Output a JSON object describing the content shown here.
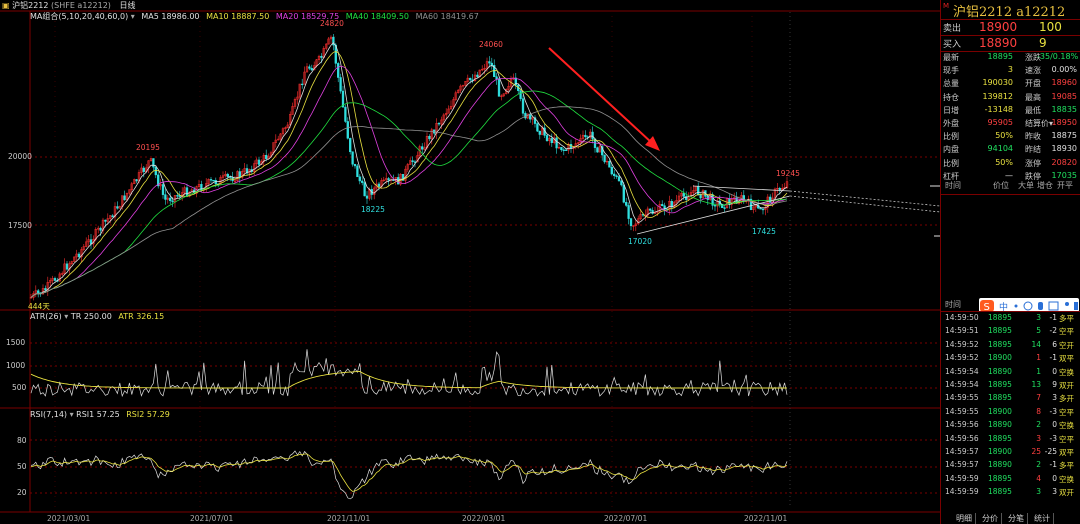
{
  "header": {
    "symbol": "沪铝2212",
    "exchange": "(SHFE a12212)",
    "period": "日线"
  },
  "ma": {
    "label": "MA组合(5,10,20,40,60,0)",
    "items": [
      {
        "text": "MA5 18986.00",
        "color": "#e0e0e0"
      },
      {
        "text": "MA10 18887.50",
        "color": "#e8e040"
      },
      {
        "text": "MA20 18529.75",
        "color": "#e040e0"
      },
      {
        "text": "MA40 18409.50",
        "color": "#20e040"
      },
      {
        "text": "MA60 18419.67",
        "color": "#909090"
      }
    ]
  },
  "atr": {
    "label": "ATR(26)",
    "tr": "TR 250.00",
    "atr": "ATR 326.15"
  },
  "rsi": {
    "label": "RSI(7,14)",
    "rsi1": "RSI1 57.25",
    "rsi2": "RSI2 57.29"
  },
  "price_axis": [
    "20000",
    "17500"
  ],
  "atr_axis": [
    "1500",
    "1000",
    "500"
  ],
  "rsi_axis": [
    "80",
    "50",
    "20"
  ],
  "date_axis": [
    "2021/03/01",
    "2021/07/01",
    "2021/11/01",
    "2022/03/01",
    "2022/07/01",
    "2022/11/01"
  ],
  "annotations": {
    "p24820": "24820",
    "p24060": "24060",
    "p20195": "20195",
    "p18225": "18225",
    "p17020": "17020",
    "p17425": "17425",
    "p19245": "19245",
    "low": "444天"
  },
  "colors": {
    "candle_up": "#ff3030",
    "candle_down": "#30e0e0",
    "arrow": "#ff2020",
    "grid": "#7a0000"
  },
  "right_panel": {
    "m": "M",
    "title": "沪铝2212 a12212",
    "sell": {
      "label": "卖出",
      "price": "18900",
      "vol": "100"
    },
    "buy": {
      "label": "买入",
      "price": "18890",
      "vol": "9"
    },
    "quotes": [
      {
        "k1": "最新",
        "v1": "18895",
        "c1": "grn",
        "k2": "涨跌",
        "v2": "-35/0.18%",
        "c2": "grn"
      },
      {
        "k1": "现手",
        "v1": "3",
        "c1": "yel",
        "k2": "速涨",
        "v2": "0.00%",
        "c2": "wht"
      },
      {
        "k1": "总量",
        "v1": "190030",
        "c1": "yel",
        "k2": "开盘",
        "v2": "18960",
        "c2": "red"
      },
      {
        "k1": "持仓",
        "v1": "139812",
        "c1": "yel",
        "k2": "最高",
        "v2": "19085",
        "c2": "red"
      },
      {
        "k1": "日增",
        "v1": "-13148",
        "c1": "yel",
        "k2": "最低",
        "v2": "18835",
        "c2": "grn"
      },
      {
        "k1": "外盘",
        "v1": "95905",
        "c1": "red",
        "k2": "结算价▾",
        "v2": "18950",
        "c2": "red"
      },
      {
        "k1": "比例",
        "v1": "50%",
        "c1": "yel",
        "k2": "昨收",
        "v2": "18875",
        "c2": "wht"
      },
      {
        "k1": "内盘",
        "v1": "94104",
        "c1": "grn",
        "k2": "昨结",
        "v2": "18930",
        "c2": "wht"
      },
      {
        "k1": "比例",
        "v1": "50%",
        "c1": "yel",
        "k2": "涨停",
        "v2": "20820",
        "c2": "red"
      },
      {
        "k1": "杠杆",
        "v1": "—",
        "c1": "wht",
        "k2": "跌停",
        "v2": "17035",
        "c2": "grn"
      }
    ],
    "detail_header": {
      "time": "时间",
      "price": "价位",
      "bigorder": "大单",
      "oi": "增仓",
      "open": "开平"
    },
    "ticks_header": "时间",
    "ticks": [
      {
        "t": "14:59:50",
        "p": "18895",
        "pc": "grn",
        "v": "3",
        "vc": "grn",
        "oi": "-1",
        "ty": "多平",
        "tc": "yel"
      },
      {
        "t": "14:59:51",
        "p": "18895",
        "pc": "grn",
        "v": "5",
        "vc": "grn",
        "oi": "-2",
        "ty": "空平",
        "tc": "yel"
      },
      {
        "t": "14:59:52",
        "p": "18895",
        "pc": "grn",
        "v": "14",
        "vc": "grn",
        "oi": "6",
        "ty": "空开",
        "tc": "yel"
      },
      {
        "t": "14:59:52",
        "p": "18900",
        "pc": "grn",
        "v": "1",
        "vc": "red",
        "oi": "-1",
        "ty": "双平",
        "tc": "yel"
      },
      {
        "t": "14:59:54",
        "p": "18890",
        "pc": "grn",
        "v": "1",
        "vc": "grn",
        "oi": "0",
        "ty": "空换",
        "tc": "yel"
      },
      {
        "t": "14:59:54",
        "p": "18895",
        "pc": "grn",
        "v": "13",
        "vc": "grn",
        "oi": "9",
        "ty": "双开",
        "tc": "yel"
      },
      {
        "t": "14:59:55",
        "p": "18895",
        "pc": "grn",
        "v": "7",
        "vc": "red",
        "oi": "3",
        "ty": "多开",
        "tc": "yel"
      },
      {
        "t": "14:59:55",
        "p": "18900",
        "pc": "grn",
        "v": "8",
        "vc": "red",
        "oi": "-3",
        "ty": "空平",
        "tc": "yel"
      },
      {
        "t": "14:59:56",
        "p": "18890",
        "pc": "grn",
        "v": "2",
        "vc": "grn",
        "oi": "0",
        "ty": "空换",
        "tc": "yel"
      },
      {
        "t": "14:59:56",
        "p": "18895",
        "pc": "grn",
        "v": "3",
        "vc": "red",
        "oi": "-3",
        "ty": "空平",
        "tc": "yel"
      },
      {
        "t": "14:59:57",
        "p": "18900",
        "pc": "grn",
        "v": "25",
        "vc": "red",
        "oi": "-25",
        "ty": "双平",
        "tc": "yel"
      },
      {
        "t": "14:59:57",
        "p": "18890",
        "pc": "grn",
        "v": "2",
        "vc": "grn",
        "oi": "-1",
        "ty": "多平",
        "tc": "yel"
      },
      {
        "t": "14:59:59",
        "p": "18895",
        "pc": "grn",
        "v": "4",
        "vc": "red",
        "oi": "0",
        "ty": "空换",
        "tc": "yel"
      },
      {
        "t": "14:59:59",
        "p": "18895",
        "pc": "grn",
        "v": "3",
        "vc": "grn",
        "oi": "3",
        "ty": "双开",
        "tc": "yel"
      }
    ],
    "tabs": [
      "明细",
      "分价",
      "分笔",
      "统计"
    ]
  }
}
